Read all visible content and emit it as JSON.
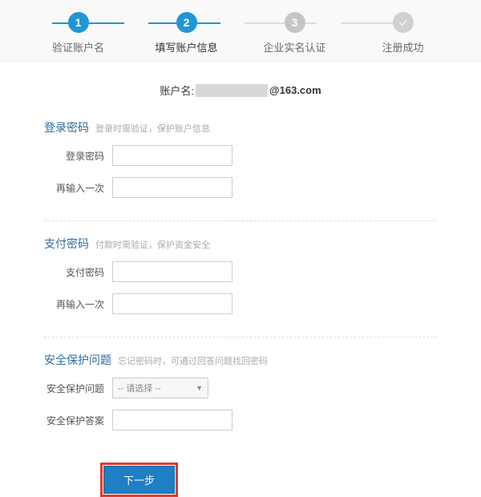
{
  "steps": {
    "s1": {
      "num": "1",
      "label": "验证账户名"
    },
    "s2": {
      "num": "2",
      "label": "填写账户信息"
    },
    "s3": {
      "num": "3",
      "label": "企业实名认证"
    },
    "s4": {
      "label": "注册成功"
    }
  },
  "account": {
    "label": "账户名:",
    "domain": "@163.com"
  },
  "login_pw": {
    "title": "登录密码",
    "hint": "登录时需验证，保护账户信息",
    "field1": "登录密码",
    "field2": "再输入一次"
  },
  "pay_pw": {
    "title": "支付密码",
    "hint": "付款时需验证，保护资金安全",
    "field1": "支付密码",
    "field2": "再输入一次"
  },
  "security": {
    "title": "安全保护问题",
    "hint": "忘记密码时，可通过回答问题找回密码",
    "field1": "安全保护问题",
    "select_placeholder": "-- 请选择 --",
    "field2": "安全保护答案"
  },
  "submit": "下一步"
}
